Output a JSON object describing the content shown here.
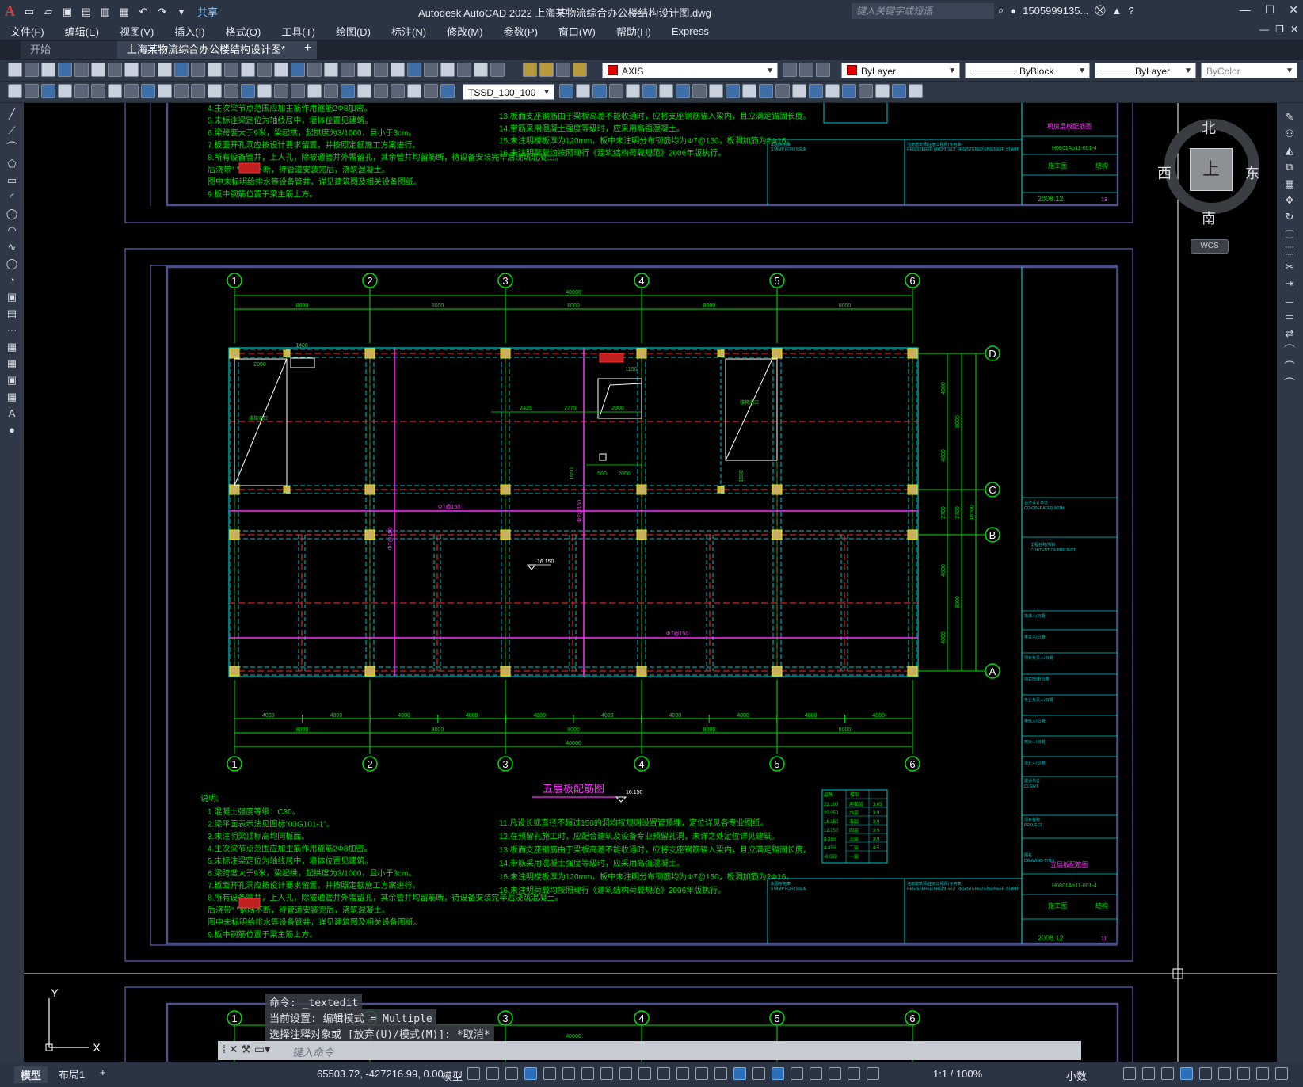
{
  "app": {
    "logo": "A",
    "title": "Autodesk AutoCAD 2022    上海某物流综合办公楼结构设计图.dwg",
    "share": "共享",
    "search_placeholder": "键入关键字或短语",
    "user": "1505999135...",
    "help": "?"
  },
  "menu": [
    "文件(F)",
    "编辑(E)",
    "视图(V)",
    "插入(I)",
    "格式(O)",
    "工具(T)",
    "绘图(D)",
    "标注(N)",
    "修改(M)",
    "参数(P)",
    "窗口(W)",
    "帮助(H)",
    "Express"
  ],
  "tabs": {
    "start": "开始",
    "active": "上海某物流综合办公楼结构设计图*",
    "add": "+"
  },
  "toolbar": {
    "layer": "AXIS",
    "color": "ByLayer",
    "linetype": "ByBlock",
    "lineweight": "ByLayer",
    "plotstyle": "ByColor",
    "dimstyle": "TSSD_100_100"
  },
  "viewcube": {
    "north": "北",
    "south": "南",
    "west": "西",
    "east": "东",
    "face": "上",
    "wcs": "WCS"
  },
  "drawing": {
    "plan_title": "五层板配筋图",
    "col_labels": [
      "1",
      "2",
      "3",
      "4",
      "5",
      "6"
    ],
    "row_labels": [
      "D",
      "C",
      "B",
      "A"
    ],
    "total_dim": "40000",
    "bay_dims": [
      "8000",
      "8000",
      "8000",
      "8000",
      "8000"
    ],
    "half_dims": [
      "4000",
      "4000",
      "4000",
      "4000",
      "4000",
      "4000",
      "4000",
      "4000",
      "4000",
      "4000"
    ],
    "right_dims": [
      "4000",
      "4000",
      "2700",
      "4000",
      "4000"
    ],
    "right_dims2": [
      "8000",
      "2700",
      "8000"
    ],
    "right_total": "18700",
    "plan_dims": [
      "1400",
      "2850",
      "2425",
      "2775",
      "2800",
      "1150",
      "500",
      "2050",
      "1650",
      "1550"
    ],
    "elev_mark": "16.150",
    "notes_heading": "说明:",
    "notes_left": [
      "1.混凝土强度等级：C30。",
      "2.梁平面表示法见图标\"03G101-1\"。",
      "3.未注明梁顶标高均同板面。",
      "4.主次梁节点范围应加主筋作用箍筋2Φ8加密。",
      "5.未标注梁定位为轴线居中，墙体位置见建筑。",
      "6.梁跨度大于9米，梁起拱，起拱度为3/1000，且小于3cm。",
      "7.板面开孔洞应按设计要求留置，并按照定额施工方案进行。",
      "8.所有设备管井，上人孔，除被通管井外需留孔，其余管井均留筋断，待设备安装完毕后浇筑混凝土。",
      "  后浇带\"      \"钢筋不断，待管道安装完后，浇筑混凝土。",
      "  图中未标明给排水等设备管井，详见建筑图及相关设备图纸。",
      "9.板中钢筋位置于梁主筋上方。"
    ],
    "notes_right": [
      "11.凡设长或直径不超过150的洞均按规则设置管预埋，定位详见各专业图纸。",
      "12.在预留孔施工时，应配合建筑及设备专业预留孔洞，未详之处定位详见建筑。",
      "13.板面支座钢筋由于梁板高差不能收通时，应将支座钢筋锚入梁内，且应满足锚固长度。",
      "14.带筋采用混凝土强度等级时，应采用高强混凝土。",
      "15.未注明楼板厚为120mm，板中未注明分布钢筋均为Φ7@150，板洞加筋为2Φ16。",
      "16.未注明荷载均按照现行《建筑结构荷载规范》2006年版执行。"
    ],
    "elev_table": {
      "headers": [
        "层高",
        "楼层"
      ],
      "rows": [
        [
          "23.100",
          "屋面层",
          "3.05"
        ],
        [
          "20.050",
          "六层",
          "3.9"
        ],
        [
          "16.150",
          "五层",
          "3.9"
        ],
        [
          "12.250",
          "四层",
          "3.9"
        ],
        [
          "8.350",
          "三层",
          "3.9"
        ],
        [
          "4.450",
          "二层",
          "4.5"
        ],
        [
          "-0.050",
          "一层",
          ""
        ]
      ]
    },
    "tb_labels": [
      "合作设计单位",
      "CO-OPERATED WITH",
      "工程名称/项目",
      "CONTENT OF PROJECT",
      "批准人/日期",
      "审定人/日期",
      "项目负责人/日期",
      "项目经理/日期",
      "专业负责人/日期",
      "审核人/日期",
      "校对人/日期",
      "设计人/日期",
      "建设单位",
      "CLIENT",
      "项目名称",
      "PROJECT",
      "图名",
      "DRAWING TITLE",
      "出图专用章",
      "STAMP FOR ISSUE",
      "注册建筑师(注册工程师)专用章",
      "REGISTERED ARCHITECT REGISTERED ENGINEER STAMP"
    ],
    "tb_drawing_title": "五层板配筋图",
    "tb_drawing_title_top": "机房层板配筋图",
    "tb_jobno": "H0801Ao11-001-4",
    "tb_status": "施工图",
    "tb_discipline": "结构",
    "tb_date": "2008.12",
    "tb_sheet": "11",
    "tb_sheet_top": "13",
    "rebar_labels": [
      "Φ7@150",
      "Φ7@150",
      "Φ7@150",
      "Φ7@150"
    ],
    "small_labels": [
      "楼梯洞口",
      "楼梯洞口"
    ]
  },
  "command": {
    "history": [
      "命令: _textedit",
      "当前设置: 编辑模式 = Multiple",
      "选择注释对象或 [放弃(U)/模式(M)]: *取消*"
    ],
    "placeholder": "键入命令"
  },
  "status": {
    "tabs": [
      "模型",
      "布局1"
    ],
    "coords": "65503.72, -427216.99, 0.00",
    "space": "模型",
    "scale": "1:1 / 100%",
    "units": "小数"
  },
  "ucs": {
    "y": "Y",
    "x": "X"
  }
}
